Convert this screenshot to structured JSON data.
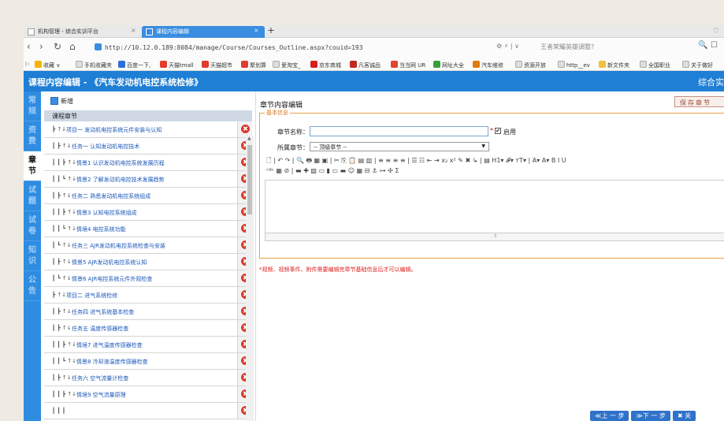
{
  "browser": {
    "tabs": [
      {
        "label": "机构管理 - 综合实训平台",
        "close": "×"
      },
      {
        "label": "课程内容编辑",
        "close": "×"
      }
    ],
    "new_tab": "+",
    "window_controls": "♡",
    "back": "‹",
    "forward": "›",
    "reload": "↻",
    "home": "⌂",
    "url": "http://10.12.0.189:8084/manage/Course/Courses_Outline.aspx?couid=193",
    "nav_icons": "⚙ ⚡ | ∨",
    "search_hint": "王者荣耀英雄调整?",
    "nav_end": "🔍  ☐",
    "bookmarks": [
      "收藏",
      "手机收藏夹",
      "百度一下,",
      "天猫tmall",
      "天猫超市",
      "聚划算",
      "爱淘宝_",
      "京东商城",
      "凡客诚品",
      "当当网 UR",
      "网址大全",
      "汽车维修",
      "资源开放",
      "http__ev",
      "新文件夹",
      "全国职业",
      "关于做好"
    ]
  },
  "app": {
    "title": "课程内容编辑 - 《汽车发动机电控系统检修》",
    "right_label": "综合实"
  },
  "sidebar": {
    "items": [
      "常 规",
      "资 费",
      "章 节",
      "试 题",
      "试 卷",
      "知 识",
      "公 告"
    ],
    "active_index": 2
  },
  "left": {
    "add_label": "新增",
    "tree_header": "课程章节",
    "delete_glyph": "✖",
    "rows": [
      {
        "indent": "┣ ↑↓ ",
        "text": "项目一 发动机电控系统元件安装与认知"
      },
      {
        "indent": "┃  ┣ ↑↓ ",
        "text": "任务一 认知发动机电控技术"
      },
      {
        "indent": "┃  ┃  ┣ ↑↓ ",
        "text": "情景1 认识发动机电控系统发展历程"
      },
      {
        "indent": "┃  ┃  ┗ ↑↓ ",
        "text": "情景2 了解发动机电控技术发展趋势"
      },
      {
        "indent": "┃  ┣ ↑↓ ",
        "text": "任务二 熟悉发动机电控系统组成"
      },
      {
        "indent": "┃  ┃  ┣ ↑↓ ",
        "text": "情景3 认知电控系统组成"
      },
      {
        "indent": "┃  ┃  ┗ ↑↓ ",
        "text": "情境4 电控系统功能"
      },
      {
        "indent": "┃  ┗ ↑↓ ",
        "text": "任务三 AJR发动机电控系统检查与安装"
      },
      {
        "indent": "┃     ┣ ↑↓ ",
        "text": "情景5 AJR发动机电控系统认知"
      },
      {
        "indent": "┃     ┗ ↑↓ ",
        "text": "情景6 AJR电控系统元件外观检查"
      },
      {
        "indent": "┣ ↑↓ ",
        "text": "项目二 进气系统检修"
      },
      {
        "indent": "┃  ┣ ↑↓ ",
        "text": "任务四 进气系统基本检查"
      },
      {
        "indent": "┃  ┣ ↑↓ ",
        "text": "任务五 温度传感器检查"
      },
      {
        "indent": "┃  ┃  ┣ ↑↓ ",
        "text": "情境7 进气温度传感器检查"
      },
      {
        "indent": "┃  ┃  ┗ ↑↓ ",
        "text": "情景8 冷却液温度传感器检查"
      },
      {
        "indent": "┃  ┣ ↑↓ ",
        "text": "任务六 空气流量计检查"
      },
      {
        "indent": "┃  ┃  ┣ ↑↓ ",
        "text": "情境9 空气流量原理"
      },
      {
        "indent": "┃  ┃  ┃ ",
        "text": ""
      }
    ],
    "scroll_up": "▲",
    "scroll_down": "▼"
  },
  "editor": {
    "title": "章节内容编辑",
    "save_label": "保存章节",
    "legend": "基本信息",
    "name_label": "章节名称：",
    "name_value": "",
    "required_mark": "*",
    "check_mark": "✔",
    "enable_label": "启用",
    "parent_label": "所属章节：",
    "parent_value": "-- 顶级章节 --",
    "dropdown_arrow": "▼",
    "toolbar1": "🗋 | ↶ ↷ | 🔍 🖶 ▦ ▣ | ✂ ⎘ 📋 ▤ ▥ | ≡ ≡ ≡ ≡ | ☰ ☷ ⇤ ⇥ x₂ x² ✎ ✖ ↳ | ▤ H1▾ 𝓕▾ ᴛT▾ | A▾ A▾ B I U",
    "toolbar2": "ᴬᴮᶜ ▦ ⊘ | ▬ ✚ ▧ ▭ ▮ ▭ ▬ ☺ ▦ ⊟ ⚓ ⊶ ✣ Σ",
    "resize_handle": "⇕",
    "note": "*视频、视频事件、附件需要编辑完章节基础信息后才可以编辑。"
  },
  "bottom_buttons": [
    "≪上 一 步",
    "≫下 一 步",
    "✖ 关"
  ]
}
